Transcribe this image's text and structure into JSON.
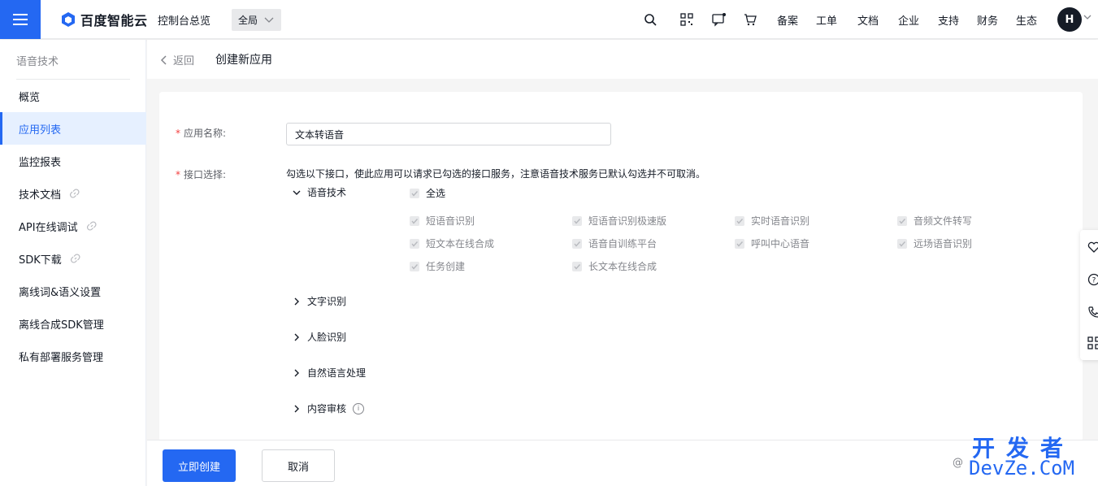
{
  "header": {
    "logo_text": "百度智能云",
    "console_link": "控制台总览",
    "region": "全局",
    "nav": [
      "备案",
      "工单",
      "文档",
      "企业",
      "支持",
      "财务",
      "生态"
    ],
    "avatar_initial": "H"
  },
  "sidebar": {
    "title": "语音技术",
    "items": [
      {
        "label": "概览",
        "external": false
      },
      {
        "label": "应用列表",
        "external": false
      },
      {
        "label": "监控报表",
        "external": false
      },
      {
        "label": "技术文档",
        "external": true
      },
      {
        "label": "API在线调试",
        "external": true
      },
      {
        "label": "SDK下载",
        "external": true
      },
      {
        "label": "离线词&语义设置",
        "external": false
      },
      {
        "label": "离线合成SDK管理",
        "external": false
      },
      {
        "label": "私有部署服务管理",
        "external": false
      }
    ],
    "active_index": 1
  },
  "page": {
    "back_label": "返回",
    "title": "创建新应用"
  },
  "form": {
    "name_label": "应用名称:",
    "name_value": "文本转语音",
    "api_label": "接口选择:",
    "api_hint": "勾选以下接口，使此应用可以请求已勾选的接口服务，注意语音技术服务已默认勾选并不可取消。",
    "groups": [
      {
        "label": "语音技术",
        "expanded": true
      },
      {
        "label": "文字识别",
        "expanded": false
      },
      {
        "label": "人脸识别",
        "expanded": false
      },
      {
        "label": "自然语言处理",
        "expanded": false
      },
      {
        "label": "内容审核",
        "expanded": false
      }
    ],
    "select_all": "全选",
    "speech_apis": [
      "短语音识别",
      "短语音识别极速版",
      "实时语音识别",
      "音频文件转写",
      "短文本在线合成",
      "语音自训练平台",
      "呼叫中心语音",
      "远场语音识别",
      "任务创建",
      "长文本在线合成"
    ]
  },
  "footer": {
    "create_label": "立即创建",
    "cancel_label": "取消"
  },
  "watermark": {
    "cn": "开发者",
    "en": "DevZe.CoM",
    "at": "@"
  },
  "colors": {
    "primary": "#2468f2",
    "text": "#151b26",
    "muted": "#84868c",
    "active_bg": "#e6f0ff"
  }
}
